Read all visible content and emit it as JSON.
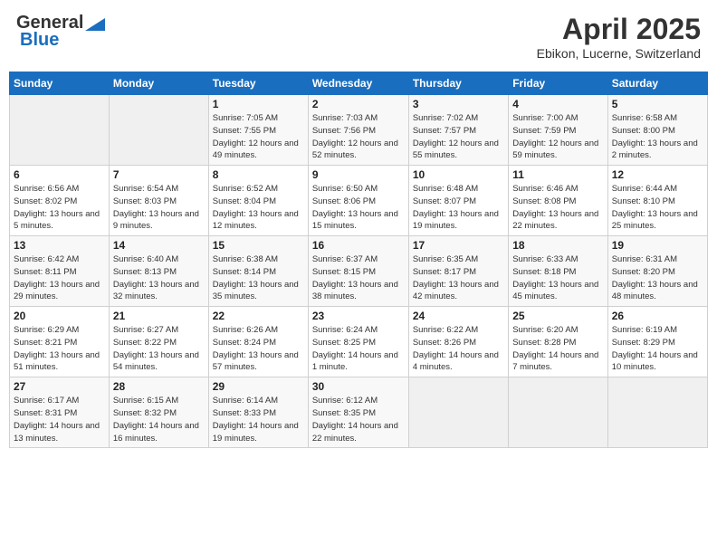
{
  "header": {
    "logo_general": "General",
    "logo_blue": "Blue",
    "month": "April 2025",
    "location": "Ebikon, Lucerne, Switzerland"
  },
  "days_of_week": [
    "Sunday",
    "Monday",
    "Tuesday",
    "Wednesday",
    "Thursday",
    "Friday",
    "Saturday"
  ],
  "weeks": [
    [
      {
        "day": "",
        "info": ""
      },
      {
        "day": "",
        "info": ""
      },
      {
        "day": "1",
        "info": "Sunrise: 7:05 AM\nSunset: 7:55 PM\nDaylight: 12 hours and 49 minutes."
      },
      {
        "day": "2",
        "info": "Sunrise: 7:03 AM\nSunset: 7:56 PM\nDaylight: 12 hours and 52 minutes."
      },
      {
        "day": "3",
        "info": "Sunrise: 7:02 AM\nSunset: 7:57 PM\nDaylight: 12 hours and 55 minutes."
      },
      {
        "day": "4",
        "info": "Sunrise: 7:00 AM\nSunset: 7:59 PM\nDaylight: 12 hours and 59 minutes."
      },
      {
        "day": "5",
        "info": "Sunrise: 6:58 AM\nSunset: 8:00 PM\nDaylight: 13 hours and 2 minutes."
      }
    ],
    [
      {
        "day": "6",
        "info": "Sunrise: 6:56 AM\nSunset: 8:02 PM\nDaylight: 13 hours and 5 minutes."
      },
      {
        "day": "7",
        "info": "Sunrise: 6:54 AM\nSunset: 8:03 PM\nDaylight: 13 hours and 9 minutes."
      },
      {
        "day": "8",
        "info": "Sunrise: 6:52 AM\nSunset: 8:04 PM\nDaylight: 13 hours and 12 minutes."
      },
      {
        "day": "9",
        "info": "Sunrise: 6:50 AM\nSunset: 8:06 PM\nDaylight: 13 hours and 15 minutes."
      },
      {
        "day": "10",
        "info": "Sunrise: 6:48 AM\nSunset: 8:07 PM\nDaylight: 13 hours and 19 minutes."
      },
      {
        "day": "11",
        "info": "Sunrise: 6:46 AM\nSunset: 8:08 PM\nDaylight: 13 hours and 22 minutes."
      },
      {
        "day": "12",
        "info": "Sunrise: 6:44 AM\nSunset: 8:10 PM\nDaylight: 13 hours and 25 minutes."
      }
    ],
    [
      {
        "day": "13",
        "info": "Sunrise: 6:42 AM\nSunset: 8:11 PM\nDaylight: 13 hours and 29 minutes."
      },
      {
        "day": "14",
        "info": "Sunrise: 6:40 AM\nSunset: 8:13 PM\nDaylight: 13 hours and 32 minutes."
      },
      {
        "day": "15",
        "info": "Sunrise: 6:38 AM\nSunset: 8:14 PM\nDaylight: 13 hours and 35 minutes."
      },
      {
        "day": "16",
        "info": "Sunrise: 6:37 AM\nSunset: 8:15 PM\nDaylight: 13 hours and 38 minutes."
      },
      {
        "day": "17",
        "info": "Sunrise: 6:35 AM\nSunset: 8:17 PM\nDaylight: 13 hours and 42 minutes."
      },
      {
        "day": "18",
        "info": "Sunrise: 6:33 AM\nSunset: 8:18 PM\nDaylight: 13 hours and 45 minutes."
      },
      {
        "day": "19",
        "info": "Sunrise: 6:31 AM\nSunset: 8:20 PM\nDaylight: 13 hours and 48 minutes."
      }
    ],
    [
      {
        "day": "20",
        "info": "Sunrise: 6:29 AM\nSunset: 8:21 PM\nDaylight: 13 hours and 51 minutes."
      },
      {
        "day": "21",
        "info": "Sunrise: 6:27 AM\nSunset: 8:22 PM\nDaylight: 13 hours and 54 minutes."
      },
      {
        "day": "22",
        "info": "Sunrise: 6:26 AM\nSunset: 8:24 PM\nDaylight: 13 hours and 57 minutes."
      },
      {
        "day": "23",
        "info": "Sunrise: 6:24 AM\nSunset: 8:25 PM\nDaylight: 14 hours and 1 minute."
      },
      {
        "day": "24",
        "info": "Sunrise: 6:22 AM\nSunset: 8:26 PM\nDaylight: 14 hours and 4 minutes."
      },
      {
        "day": "25",
        "info": "Sunrise: 6:20 AM\nSunset: 8:28 PM\nDaylight: 14 hours and 7 minutes."
      },
      {
        "day": "26",
        "info": "Sunrise: 6:19 AM\nSunset: 8:29 PM\nDaylight: 14 hours and 10 minutes."
      }
    ],
    [
      {
        "day": "27",
        "info": "Sunrise: 6:17 AM\nSunset: 8:31 PM\nDaylight: 14 hours and 13 minutes."
      },
      {
        "day": "28",
        "info": "Sunrise: 6:15 AM\nSunset: 8:32 PM\nDaylight: 14 hours and 16 minutes."
      },
      {
        "day": "29",
        "info": "Sunrise: 6:14 AM\nSunset: 8:33 PM\nDaylight: 14 hours and 19 minutes."
      },
      {
        "day": "30",
        "info": "Sunrise: 6:12 AM\nSunset: 8:35 PM\nDaylight: 14 hours and 22 minutes."
      },
      {
        "day": "",
        "info": ""
      },
      {
        "day": "",
        "info": ""
      },
      {
        "day": "",
        "info": ""
      }
    ]
  ]
}
